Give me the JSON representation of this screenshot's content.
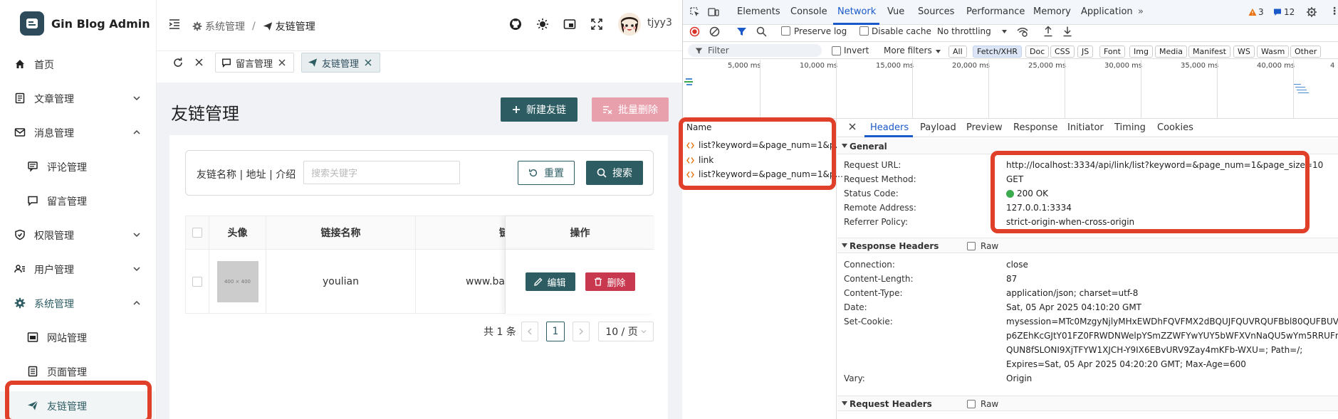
{
  "app": {
    "logo_text": "Gin Blog Admin"
  },
  "sidebar": {
    "items": [
      {
        "label": "首页",
        "icon": "home-icon"
      },
      {
        "label": "文章管理",
        "icon": "article-icon"
      },
      {
        "label": "消息管理",
        "icon": "mail-icon"
      },
      {
        "label": "评论管理",
        "icon": "comment-icon"
      },
      {
        "label": "留言管理",
        "icon": "message-icon"
      },
      {
        "label": "权限管理",
        "icon": "shield-icon"
      },
      {
        "label": "用户管理",
        "icon": "users-icon"
      },
      {
        "label": "系统管理",
        "icon": "gear-icon"
      },
      {
        "label": "网站管理",
        "icon": "website-icon"
      },
      {
        "label": "页面管理",
        "icon": "page-icon"
      },
      {
        "label": "友链管理",
        "icon": "send-icon"
      }
    ]
  },
  "header": {
    "breadcrumb_1": "系统管理",
    "breadcrumb_sep": "/",
    "breadcrumb_2": "友链管理",
    "username": "tjyy3"
  },
  "tabs": {
    "tab1": "留言管理",
    "tab2": "友链管理"
  },
  "page": {
    "title": "友链管理",
    "new_button": "新建友链",
    "batch_delete_button": "批量删除",
    "search_label": "友链名称 | 地址 | 介绍",
    "search_placeholder": "搜索关键字",
    "reset_button": "重置",
    "search_button": "搜索"
  },
  "table": {
    "headers": [
      "头像",
      "链接名称",
      "链接",
      "操作"
    ],
    "rows": [
      {
        "avatar_text": "400 × 400",
        "name": "youlian",
        "link": "www.ba",
        "edit": "编辑",
        "delete": "删除"
      }
    ]
  },
  "pagination": {
    "total": "共 1 条",
    "current_page": "1",
    "page_size": "10 / 页"
  },
  "devtools": {
    "tabs": [
      "Elements",
      "Console",
      "Network",
      "Vue",
      "Sources",
      "Performance",
      "Memory",
      "Application"
    ],
    "active_tab": "Network",
    "warnings_count": "3",
    "messages_count": "12",
    "preserve_log": "Preserve log",
    "disable_cache": "Disable cache",
    "throttling": "No throttling",
    "filter_placeholder": "Filter",
    "invert": "Invert",
    "more_filters": "More filters",
    "type_filters": [
      "All",
      "Fetch/XHR",
      "Doc",
      "CSS",
      "JS",
      "Font",
      "Img",
      "Media",
      "Manifest",
      "WS",
      "Wasm",
      "Other"
    ],
    "timeline_labels": [
      "5,000 ms",
      "10,000 ms",
      "15,000 ms",
      "20,000 ms",
      "25,000 ms",
      "30,000 ms",
      "35,000 ms",
      "40,000 ms"
    ],
    "name_header": "Name",
    "requests": [
      "list?keyword=&page_num=1&p...",
      "link",
      "list?keyword=&page_num=1&p..."
    ],
    "detail_tabs": [
      "Headers",
      "Payload",
      "Preview",
      "Response",
      "Initiator",
      "Timing",
      "Cookies"
    ],
    "general_title": "General",
    "general": [
      {
        "k": "Request URL:",
        "v": "http://localhost:3334/api/link/list?keyword=&page_num=1&page_size=10"
      },
      {
        "k": "Request Method:",
        "v": "GET"
      },
      {
        "k": "Status Code:",
        "v": "200 OK"
      },
      {
        "k": "Remote Address:",
        "v": "127.0.0.1:3334"
      },
      {
        "k": "Referrer Policy:",
        "v": "strict-origin-when-cross-origin"
      }
    ],
    "response_headers_title": "Response Headers",
    "raw": "Raw",
    "response_headers": [
      {
        "k": "Connection:",
        "v": "close"
      },
      {
        "k": "Content-Length:",
        "v": "87"
      },
      {
        "k": "Content-Type:",
        "v": "application/json; charset=utf-8"
      },
      {
        "k": "Date:",
        "v": "Sat, 05 Apr 2025 04:10:20 GMT"
      },
      {
        "k": "Set-Cookie:",
        "v": "mysession=MTc0MzgyNjlyMHxEWDhFQVFMX2dBQUJFQUVRQUFBbl80QUFBUV"
      },
      {
        "k": "",
        "v": "p6ZEhKcGJtY01FZ0FRWDNWelpYSmZZWFYwYUY5bWFXVnNaQU5wYm5RRUFn"
      },
      {
        "k": "",
        "v": "QUN8fSLONI9XjTFYW1XJCH-Y9IX6EBvURV9Zay4mKFb-WXU=; Path=/;"
      },
      {
        "k": "",
        "v": "Expires=Sat, 05 Apr 2025 04:20:20 GMT; Max-Age=600"
      },
      {
        "k": "Vary:",
        "v": "Origin"
      }
    ],
    "request_headers_title": "Request Headers"
  },
  "colors": {
    "brand": "#2d5d63",
    "annotation_red": "#e0402a",
    "devtools_blue": "#1a59c9",
    "status_green": "#3cab4e"
  }
}
